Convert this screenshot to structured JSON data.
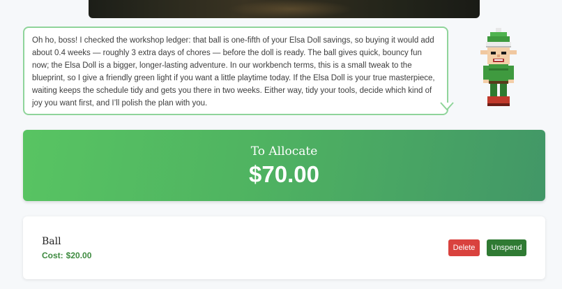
{
  "message": {
    "text": "Oh ho, boss! I checked the workshop ledger: that ball is one-fifth of your Elsa Doll savings, so buying it would add about 0.4 weeks — roughly 3 extra days of chores — before the doll is ready. The ball gives quick, bouncy fun now; the Elsa Doll is a bigger, longer-lasting adventure. In our workbench terms, this is a small tweak to the blueprint, so I give a friendly green light if you want a little playtime today. If the Elsa Doll is your true masterpiece, waiting keeps the schedule tidy and gets you there in two weeks. Either way, tidy your tools, decide which kind of joy you want first, and I’ll polish the plan with you."
  },
  "allocate": {
    "label": "To Allocate",
    "amount": "$70.00"
  },
  "item": {
    "name": "Ball",
    "cost_label": "Cost:",
    "cost_value": "$20.00",
    "delete_label": "Delete",
    "unspend_label": "Unspend"
  },
  "colors": {
    "speech_border": "#8fd49a",
    "allocate_gradient_start": "#58c462",
    "allocate_gradient_end": "#429767",
    "cost_text": "#3d8a3f",
    "delete_button": "#d9423e",
    "unspend_button": "#2f7a33"
  },
  "icons": {
    "video_chevron": "chevron-down-icon",
    "speech_tail": "speech-tail-icon",
    "character": "elf-character-icon"
  }
}
